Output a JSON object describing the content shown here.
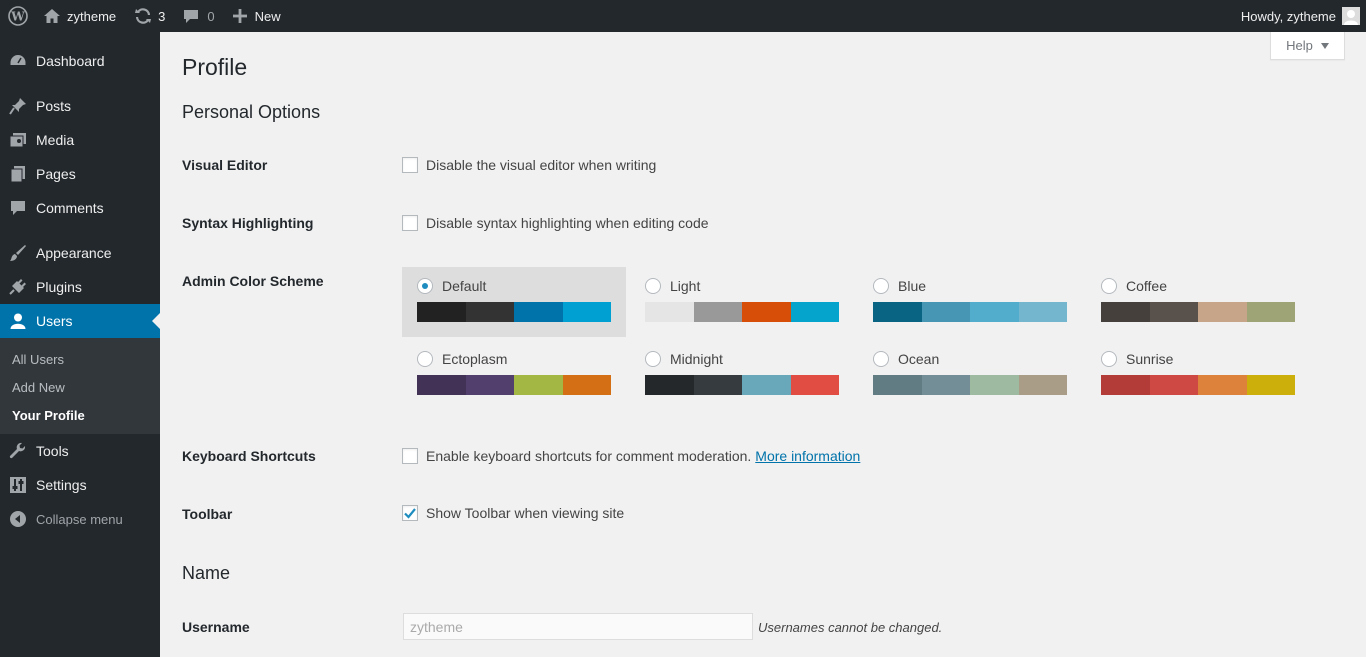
{
  "adminbar": {
    "site_name": "zytheme",
    "updates_count": "3",
    "comments_count": "0",
    "new_label": "New",
    "howdy": "Howdy, zytheme"
  },
  "sidebar": {
    "items": [
      {
        "label": "Dashboard",
        "icon": "dashboard-icon"
      },
      {
        "label": "Posts",
        "icon": "pin-icon"
      },
      {
        "label": "Media",
        "icon": "media-icon"
      },
      {
        "label": "Pages",
        "icon": "pages-icon"
      },
      {
        "label": "Comments",
        "icon": "comment-icon"
      },
      {
        "label": "Appearance",
        "icon": "brush-icon"
      },
      {
        "label": "Plugins",
        "icon": "plugin-icon"
      },
      {
        "label": "Users",
        "icon": "user-icon"
      },
      {
        "label": "Tools",
        "icon": "wrench-icon"
      },
      {
        "label": "Settings",
        "icon": "settings-icon"
      }
    ],
    "users_submenu": [
      "All Users",
      "Add New",
      "Your Profile"
    ],
    "collapse": "Collapse menu"
  },
  "page": {
    "help": "Help",
    "title": "Profile",
    "personal_options": "Personal Options",
    "visual_editor": {
      "label": "Visual Editor",
      "option": "Disable the visual editor when writing",
      "checked": false
    },
    "syntax": {
      "label": "Syntax Highlighting",
      "option": "Disable syntax highlighting when editing code",
      "checked": false
    },
    "color_scheme_label": "Admin Color Scheme",
    "schemes": [
      {
        "name": "Default",
        "colors": [
          "#222222",
          "#333333",
          "#0073aa",
          "#00a0d2"
        ],
        "selected": true
      },
      {
        "name": "Light",
        "colors": [
          "#e5e5e5",
          "#999999",
          "#d64e07",
          "#04a4cc"
        ],
        "selected": false
      },
      {
        "name": "Blue",
        "colors": [
          "#096484",
          "#4796b3",
          "#52accc",
          "#74b6ce"
        ],
        "selected": false
      },
      {
        "name": "Coffee",
        "colors": [
          "#46403c",
          "#59524c",
          "#c7a589",
          "#9ea476"
        ],
        "selected": false
      },
      {
        "name": "Ectoplasm",
        "colors": [
          "#413256",
          "#523f6d",
          "#a3b745",
          "#d46f15"
        ],
        "selected": false
      },
      {
        "name": "Midnight",
        "colors": [
          "#25282b",
          "#363b3f",
          "#69a8bb",
          "#e14d43"
        ],
        "selected": false
      },
      {
        "name": "Ocean",
        "colors": [
          "#627c83",
          "#738e96",
          "#9ebaa0",
          "#aa9d88"
        ],
        "selected": false
      },
      {
        "name": "Sunrise",
        "colors": [
          "#b43c38",
          "#cf4944",
          "#dd823b",
          "#ccaf0b"
        ],
        "selected": false
      }
    ],
    "keyboard": {
      "label": "Keyboard Shortcuts",
      "option": "Enable keyboard shortcuts for comment moderation.",
      "link": "More information",
      "checked": false
    },
    "toolbar": {
      "label": "Toolbar",
      "option": "Show Toolbar when viewing site",
      "checked": true
    },
    "name_heading": "Name",
    "username": {
      "label": "Username",
      "value": "zytheme",
      "note": "Usernames cannot be changed."
    }
  }
}
